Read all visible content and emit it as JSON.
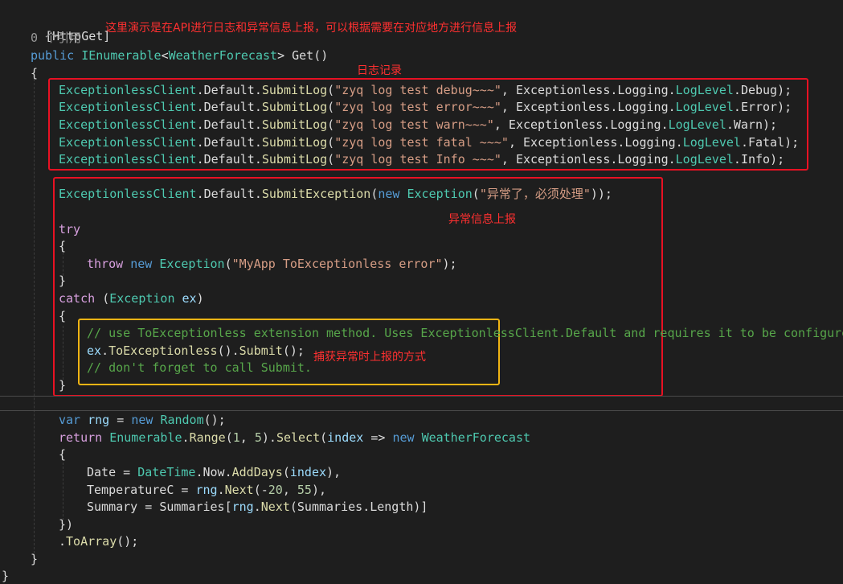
{
  "notes": {
    "top": "这里演示是在API进行日志和异常信息上报，可以根据需要在对应地方进行信息上报",
    "log": "日志记录",
    "exception": "异常信息上报",
    "capture": "捕获异常时上报的方式"
  },
  "code": {
    "attr": "[HttpGet]",
    "refs": "0 个引用",
    "sig": {
      "public": "public",
      "ienum": "IEnumerable",
      "lt": "<",
      "wf": "WeatherForecast",
      "gt": ">",
      "get": " Get()"
    },
    "open": "{",
    "logs": [
      {
        "msg": "\"zyq log test debug~~~\"",
        "level": "Debug"
      },
      {
        "msg": "\"zyq log test error~~~\"",
        "level": "Error"
      },
      {
        "msg": "\"zyq log test warn~~~\"",
        "level": "Warn"
      },
      {
        "msg": "\"zyq log test fatal ~~~\"",
        "level": "Fatal"
      },
      {
        "msg": "\"zyq log test Info ~~~\"",
        "level": "Info"
      }
    ],
    "ec": "ExceptionlessClient",
    "def": ".Default.",
    "submitlog": "SubmitLog",
    "nsLogging": ", Exceptionless.Logging.",
    "loglevel": "LogLevel",
    "submitexc": "SubmitException",
    "new": "new",
    "exception": "Exception",
    "excmsg": "\"异常了，必须处理\"",
    "try": "try",
    "throw": "throw",
    "throwmsg": "\"MyApp ToExceptionless error\"",
    "catch": "catch",
    "ex": "ex",
    "comment1": "// use ToExceptionless extension method. Uses ExceptionlessClient.Default and requires it to be configured.",
    "toexc": "ToExceptionless",
    "submit": "Submit",
    "comment2": "// don't forget to call Submit.",
    "var": "var",
    "rng": "rng",
    "random": "Random",
    "return": "return",
    "enumerable": "Enumerable",
    "range": "Range",
    "select": "Select",
    "index": "index",
    "date": "Date",
    "datetime": "DateTime",
    "now": "Now",
    "adddays": "AddDays",
    "tempc": "TemperatureC",
    "next": "Next",
    "summary": "Summary",
    "summaries": "Summaries",
    "length": "Length",
    "toarray": "ToArray"
  }
}
